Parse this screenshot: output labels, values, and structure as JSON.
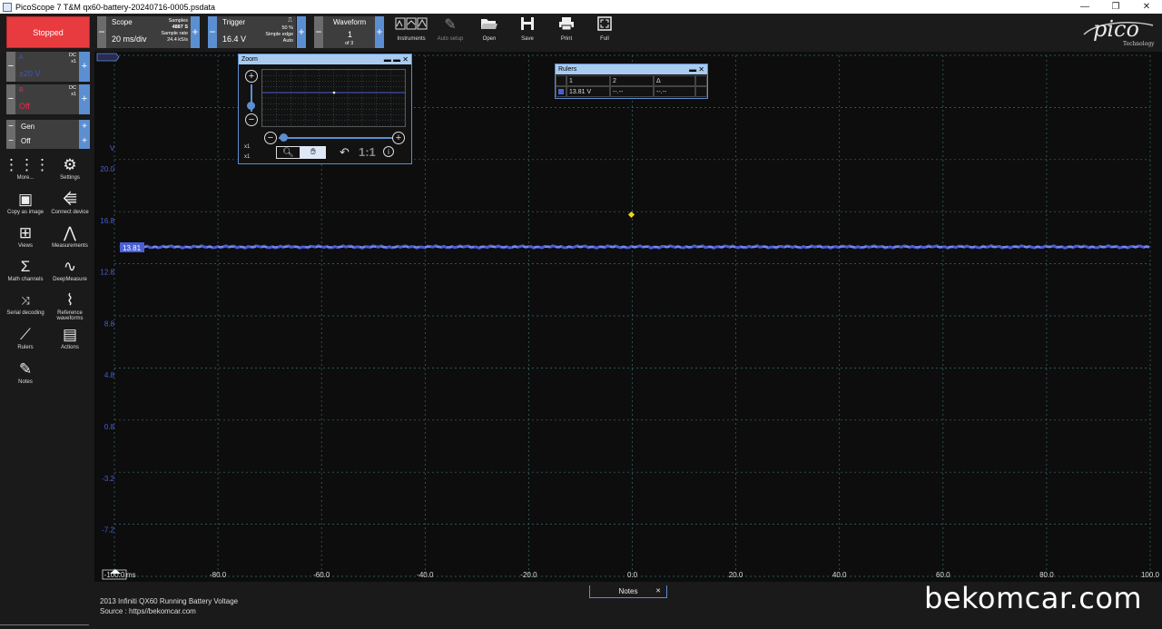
{
  "window": {
    "title": "PicoScope 7 T&M qx60-battery-20240716-0005.psdata",
    "minimize": "—",
    "restore": "❐",
    "close": "✕"
  },
  "toolbar": {
    "status": "Stopped",
    "scope": {
      "label": "Scope",
      "timebase": "20 ms/div",
      "samples_label": "Samples",
      "samples": "4887 S",
      "rate_label": "Sample rate",
      "rate": "24.4 kS/s"
    },
    "trigger": {
      "label": "Trigger",
      "level": "16.4 V",
      "percent": "50 %",
      "type": "Simple edge",
      "mode": "Auto"
    },
    "waveform": {
      "label": "Waveform",
      "number": "1",
      "of": "of 3"
    },
    "tools": [
      {
        "label": "Instruments",
        "icon": "instruments-icon"
      },
      {
        "label": "Auto setup",
        "icon": "auto-setup-icon"
      },
      {
        "label": "Open",
        "icon": "folder-open-icon"
      },
      {
        "label": "Save",
        "icon": "save-icon"
      },
      {
        "label": "Print",
        "icon": "print-icon"
      },
      {
        "label": "Full",
        "icon": "fullscreen-icon"
      }
    ],
    "logo": "pico",
    "logo_sub": "Technology"
  },
  "channels": {
    "a": {
      "name": "A",
      "range": "±20 V",
      "coupling": "DC",
      "probe": "x1",
      "color": "#3f56c4"
    },
    "b": {
      "name": "B",
      "range": "Off",
      "coupling": "DC",
      "probe": "x1",
      "color": "#e8294b"
    },
    "gen": "Gen",
    "gen_state": "Off"
  },
  "sidebar_tools": [
    {
      "label": "More...",
      "icon": "grid-dots-icon"
    },
    {
      "label": "Settings",
      "icon": "gear-icon"
    },
    {
      "label": "Copy as image",
      "icon": "image-icon"
    },
    {
      "label": "Connect device",
      "icon": "usb-icon"
    },
    {
      "label": "Views",
      "icon": "views-icon"
    },
    {
      "label": "Measurements",
      "icon": "measurements-icon"
    },
    {
      "label": "Math channels",
      "icon": "sigma-icon"
    },
    {
      "label": "DeepMeasure",
      "icon": "deepmeasure-icon"
    },
    {
      "label": "Serial decoding",
      "icon": "serial-decoding-icon"
    },
    {
      "label": "Reference waveforms",
      "icon": "reference-waveforms-icon"
    },
    {
      "label": "Rulers",
      "icon": "ruler-icon"
    },
    {
      "label": "Actions",
      "icon": "actions-icon"
    },
    {
      "label": "Notes",
      "icon": "notes-icon"
    }
  ],
  "axes": {
    "y_unit": "V",
    "y_ticks": [
      "20.0",
      "16.8",
      "12.8",
      "8.8",
      "4.8",
      "0.8",
      "-3.2",
      "-7.2"
    ],
    "x_ticks": [
      "-100.0",
      "-80.0",
      "-60.0",
      "-40.0",
      "-20.0",
      "0.0",
      "20.0",
      "40.0",
      "60.0",
      "80.0",
      "100.0"
    ],
    "x_unit": "ms",
    "ruler_value": "13.81"
  },
  "zoom_window": {
    "title": "Zoom",
    "x_label": "x1",
    "y_label": "x1",
    "ratio": "1:1"
  },
  "rulers_window": {
    "title": "Rulers",
    "headers": [
      "1",
      "2",
      "Δ"
    ],
    "row": [
      "13.81 V",
      "--.--",
      "--.--"
    ]
  },
  "notes": {
    "tab": "Notes",
    "line1": "2013 Infiniti QX60 Running Battery Voltage",
    "line2": "Source : https//bekomcar.com"
  },
  "watermark": "bekomcar.com"
}
